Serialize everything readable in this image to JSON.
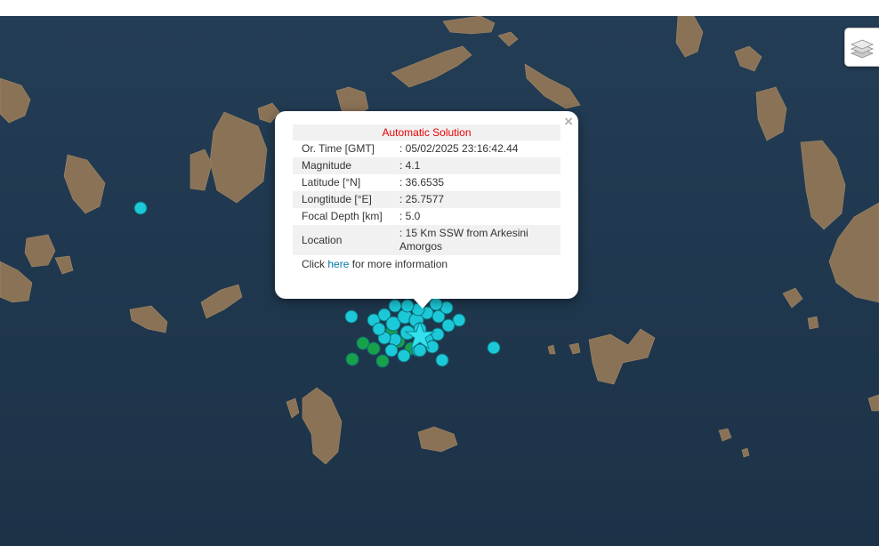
{
  "popup": {
    "title": "Automatic Solution",
    "close_symbol": "×",
    "rows": [
      {
        "label": "Or. Time [GMT]",
        "value": ": 05/02/2025 23:16:42.44"
      },
      {
        "label": "Magnitude",
        "value": ": 4.1"
      },
      {
        "label": "Latitude [°N]",
        "value": ": 36.6535"
      },
      {
        "label": "Longtitude [°E]",
        "value": ": 25.7577"
      },
      {
        "label": "Focal Depth [km]",
        "value": ": 5.0"
      },
      {
        "label": "Location",
        "value": ": 15 Km SSW from Arkesini Amorgos"
      }
    ],
    "more_prefix": "Click ",
    "more_link": "here",
    "more_suffix": " for more information"
  },
  "controls": {
    "layers_icon": "layers-icon"
  },
  "colors": {
    "sea": "#21384e",
    "land": "#8a7256",
    "marker_cyan": "#1cc9d9",
    "marker_green": "#17a24a",
    "star": "#33e0ee",
    "popup_title": "#e60000",
    "link": "#0078a8"
  }
}
